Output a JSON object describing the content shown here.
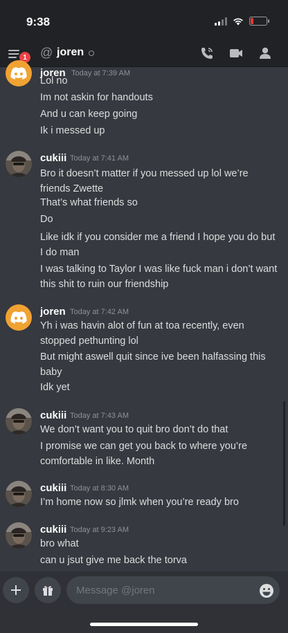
{
  "status_bar": {
    "time": "9:38"
  },
  "header": {
    "badge_count": "1",
    "at_sign": "@",
    "channel_name": "joren"
  },
  "messages": [
    {
      "author": "joren",
      "time": "Today at 7:39 AM",
      "avatar": "discord-logo",
      "lines": [
        "Lol no",
        "Im not askin for handouts",
        "And u can keep going",
        "Ik i messed up"
      ]
    },
    {
      "author": "cukiii",
      "time": "Today at 7:41 AM",
      "avatar": "user-photo",
      "lines": [
        "Bro it doesn’t matter if you messed up lol we’re friends Zwette",
        "That’s what friends so",
        "Do",
        "Like idk if you consider me a friend I hope you do but I do man",
        "I was talking to Taylor I was like fuck man i don’t want this shit to ruin our friendship"
      ]
    },
    {
      "author": "joren",
      "time": "Today at 7:42 AM",
      "avatar": "discord-logo",
      "lines": [
        "Yh i was havin alot of fun at toa recently, even stopped pethunting lol",
        "But might aswell quit since ive been halfassing this baby",
        "Idk yet"
      ]
    },
    {
      "author": "cukiii",
      "time": "Today at 7:43 AM",
      "avatar": "user-photo",
      "lines": [
        "We don’t want you to quit bro don’t do that",
        "I promise we can get you back to where you’re comfortable in like. Month"
      ]
    },
    {
      "author": "cukiii",
      "time": "Today at 8:30 AM",
      "avatar": "user-photo",
      "lines": [
        "I’m home now so jlmk when you’re ready bro"
      ]
    },
    {
      "author": "cukiii",
      "time": "Today at 9:23 AM",
      "avatar": "user-photo",
      "lines": [
        "bro what",
        "can u jsut give me back the torva"
      ]
    }
  ],
  "composer": {
    "placeholder": "Message @joren"
  },
  "colors": {
    "background": "#36393f",
    "header": "#202225",
    "discord_avatar": "#f0a232",
    "badge": "#ed4245"
  }
}
